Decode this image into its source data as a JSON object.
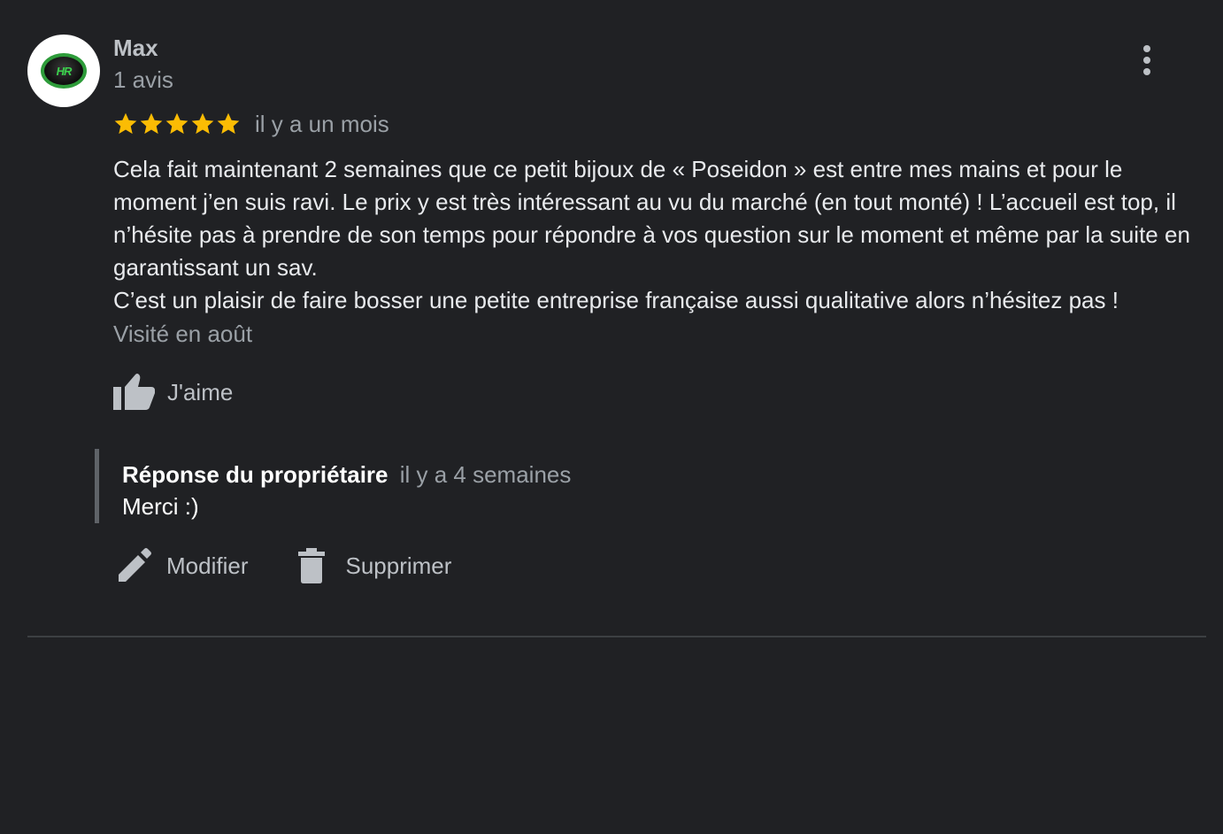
{
  "review": {
    "author": {
      "name": "Max",
      "review_count": "1 avis",
      "avatar_label": "HR"
    },
    "rating": 5,
    "date": "il y a un mois",
    "text": [
      "Cela fait maintenant 2 semaines que ce petit bijoux de « Poseidon » est entre mes mains et pour le moment j’en suis ravi. Le prix y est très intéressant au vu du marché (en tout monté) ! L’accueil est top, il n’hésite pas à prendre de son temps pour répondre à vos question sur le moment et même par la suite en garantissant un sav.",
      "C’est un plaisir de faire bosser une petite entreprise française aussi qualitative alors n’hésitez pas !"
    ],
    "visited": "Visité en août",
    "like_label": "J'aime"
  },
  "owner_reply": {
    "title": "Réponse du propriétaire",
    "date": "il y a 4 semaines",
    "text": "Merci :)"
  },
  "actions": {
    "edit_label": "Modifier",
    "delete_label": "Supprimer"
  },
  "icons": {
    "more": "more-vert-icon",
    "star": "star-icon",
    "like": "thumb-up-icon",
    "edit": "pencil-icon",
    "delete": "trash-icon"
  },
  "colors": {
    "background": "#202124",
    "star": "#fbbc04",
    "text_primary": "#e8eaed",
    "text_secondary": "#9aa0a6",
    "icon": "#bdc1c6"
  }
}
